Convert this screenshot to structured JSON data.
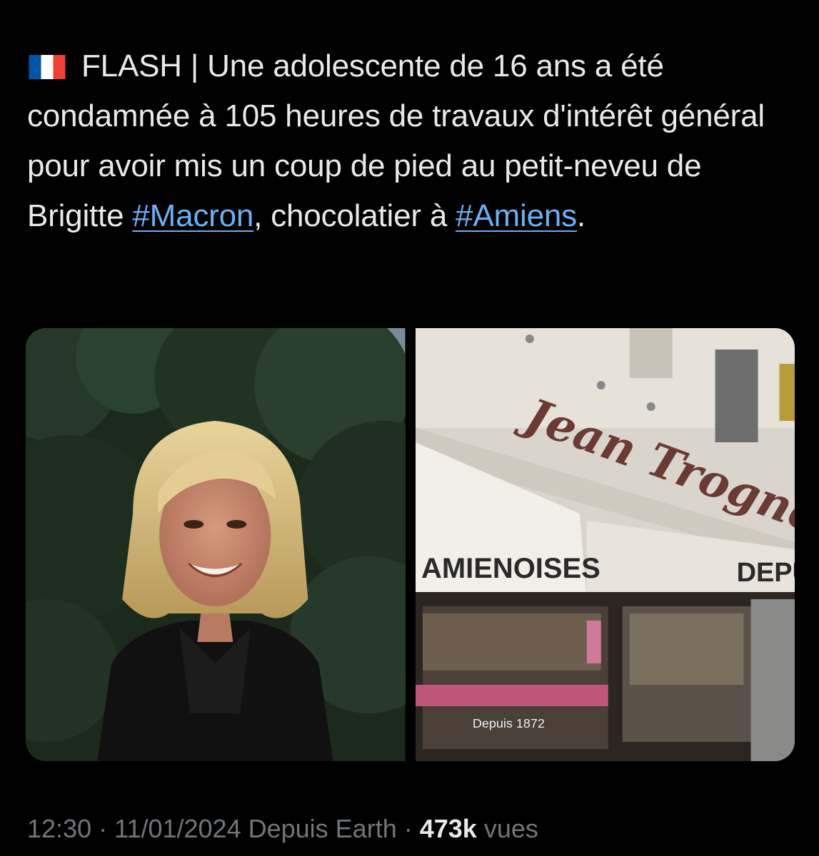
{
  "tweet": {
    "flag_icon": "france-flag-icon",
    "text_before_macron": "FLASH | Une adolescente de 16 ans a été condamnée à 105 heures de travaux d'intérêt général pour avoir mis un coup de pied au petit-neveu de Brigitte ",
    "hashtag_macron": "#Macron",
    "text_between": ", chocolatier à ",
    "hashtag_amiens": "#Amiens",
    "text_after": "."
  },
  "media": {
    "photo_1": "portrait-photo",
    "photo_2": "chocolate-shop-photo",
    "shop_sign": "Jean Trogneux",
    "awning_left": "AMIENOISES",
    "awning_right": "DEPUIS",
    "window_text": "Depuis 1872"
  },
  "meta": {
    "time": "12:30",
    "separator": " · ",
    "date": "11/01/2024",
    "source": " Depuis Earth",
    "separator2": " · ",
    "views_count": "473k",
    "views_label": " vues"
  },
  "colors": {
    "background": "#000000",
    "text": "#e7e9ea",
    "link": "#6ab0f3",
    "muted": "#71767b"
  }
}
